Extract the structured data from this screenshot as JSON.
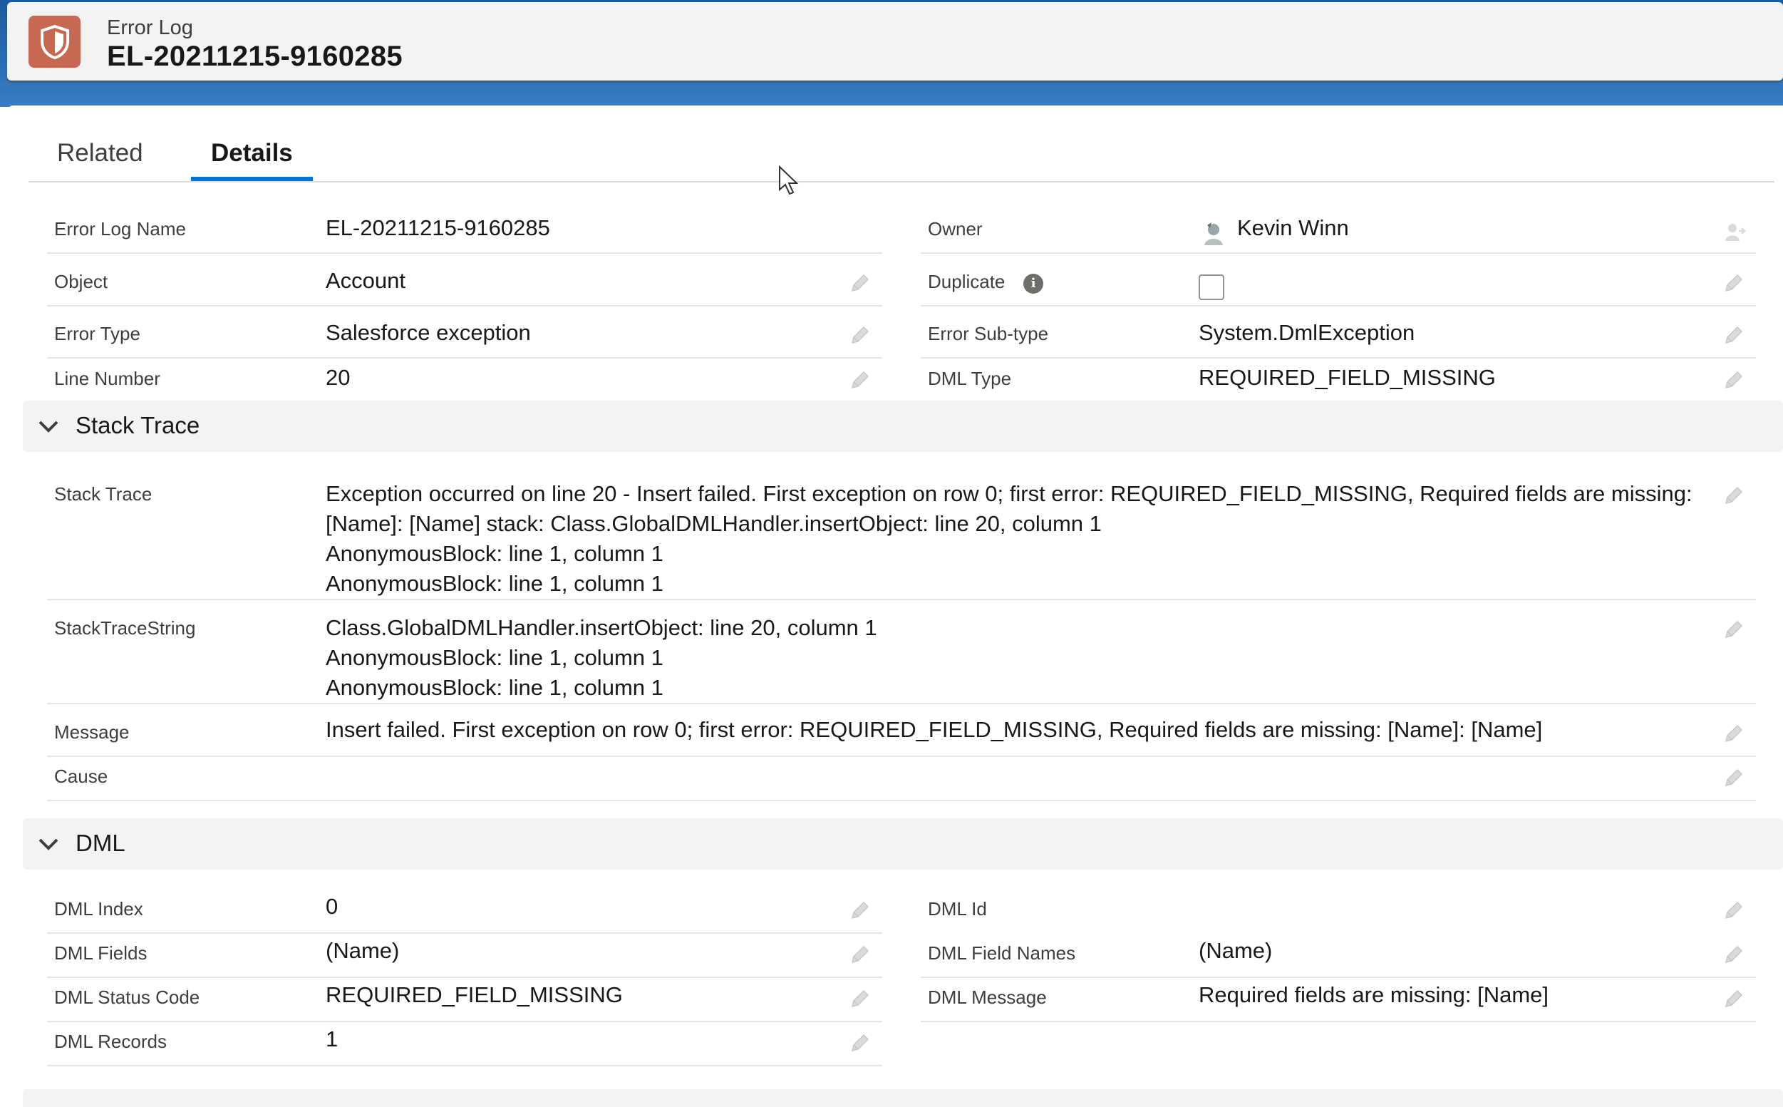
{
  "header": {
    "object_label": "Error Log",
    "record_title": "EL-20211215-9160285",
    "icon": "shield-icon"
  },
  "tabs": [
    {
      "label": "Related",
      "active": false
    },
    {
      "label": "Details",
      "active": true
    }
  ],
  "fields": {
    "error_log_name": {
      "label": "Error Log Name",
      "value": "EL-20211215-9160285"
    },
    "owner": {
      "label": "Owner",
      "value": "Kevin Winn"
    },
    "object": {
      "label": "Object",
      "value": "Account"
    },
    "duplicate": {
      "label": "Duplicate",
      "checked": false
    },
    "error_type": {
      "label": "Error Type",
      "value": "Salesforce exception"
    },
    "error_sub_type": {
      "label": "Error Sub-type",
      "value": "System.DmlException"
    },
    "line_number": {
      "label": "Line Number",
      "value": "20"
    },
    "dml_type": {
      "label": "DML Type",
      "value": "REQUIRED_FIELD_MISSING"
    }
  },
  "stack_trace_section": {
    "title": "Stack Trace",
    "stack_trace": {
      "label": "Stack Trace",
      "lines": [
        "Exception occurred on line 20 - Insert failed. First exception on row 0; first error: REQUIRED_FIELD_MISSING, Required fields are missing:",
        "[Name]: [Name] stack: Class.GlobalDMLHandler.insertObject: line 20, column 1",
        "AnonymousBlock: line 1, column 1",
        "AnonymousBlock: line 1, column 1"
      ]
    },
    "stack_trace_string": {
      "label": "StackTraceString",
      "lines": [
        "Class.GlobalDMLHandler.insertObject: line 20, column 1",
        "AnonymousBlock: line 1, column 1",
        "AnonymousBlock: line 1, column 1"
      ]
    },
    "message": {
      "label": "Message",
      "value": "Insert failed. First exception on row 0; first error: REQUIRED_FIELD_MISSING, Required fields are missing: [Name]: [Name]"
    },
    "cause": {
      "label": "Cause",
      "value": ""
    }
  },
  "dml_section": {
    "title": "DML",
    "dml_index": {
      "label": "DML Index",
      "value": "0"
    },
    "dml_id": {
      "label": "DML Id",
      "value": ""
    },
    "dml_fields": {
      "label": "DML Fields",
      "value": "(Name)"
    },
    "dml_field_names": {
      "label": "DML Field Names",
      "value": "(Name)"
    },
    "dml_status_code": {
      "label": "DML Status Code",
      "value": "REQUIRED_FIELD_MISSING"
    },
    "dml_message": {
      "label": "DML Message",
      "value": "Required fields are missing: [Name]"
    },
    "dml_records": {
      "label": "DML Records",
      "value": "1"
    }
  },
  "colors": {
    "brand": "#0176d3",
    "link": "#0b5cab",
    "icon_bg": "#c76852",
    "section_bg": "#f3f3f3"
  }
}
